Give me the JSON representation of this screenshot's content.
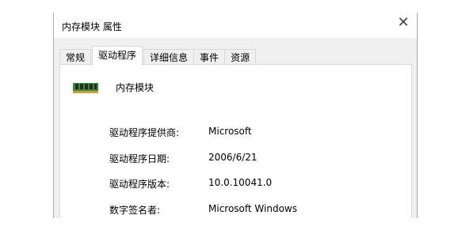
{
  "window": {
    "title": "内存模块 属性",
    "close_glyph": "✕"
  },
  "tabs": [
    {
      "label": "常规",
      "active": false
    },
    {
      "label": "驱动程序",
      "active": true
    },
    {
      "label": "详细信息",
      "active": false
    },
    {
      "label": "事件",
      "active": false
    },
    {
      "label": "资源",
      "active": false
    }
  ],
  "device": {
    "icon": "memory-module-icon",
    "name": "内存模块"
  },
  "driver_properties": [
    {
      "label": "驱动程序提供商:",
      "value": "Microsoft"
    },
    {
      "label": "驱动程序日期:",
      "value": "2006/6/21"
    },
    {
      "label": "驱动程序版本:",
      "value": "10.0.10041.0"
    },
    {
      "label": "数字签名者:",
      "value": "Microsoft Windows"
    }
  ],
  "colors": {
    "icon_green": "#3a8a3a",
    "icon_dark": "#2a2a2a",
    "icon_gold": "#c8a040"
  }
}
